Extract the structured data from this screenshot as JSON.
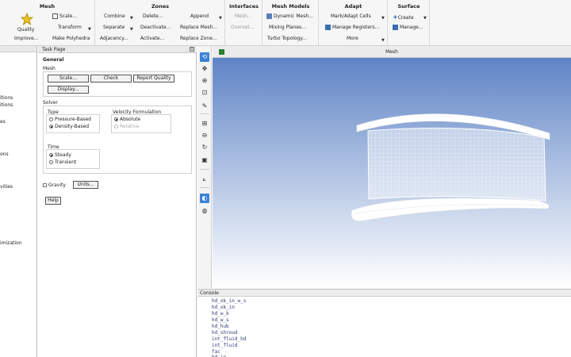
{
  "ribbon": {
    "groups": [
      {
        "title": "Mesh"
      },
      {
        "title": "Zones"
      },
      {
        "title": "Interfaces"
      },
      {
        "title": "Mesh Models"
      },
      {
        "title": "Adapt"
      },
      {
        "title": "Surface"
      }
    ],
    "mesh": {
      "quality": "Quality",
      "improve": "Improve...",
      "scale": "Scale...",
      "transform": "Transform",
      "make_polyhedra": "Make Polyhedra"
    },
    "zones": {
      "combine": "Combine",
      "separate": "Separate",
      "adjacency": "Adjacency...",
      "delete": "Delete...",
      "deactivate": "Deactivate...",
      "activate": "Activate...",
      "append": "Append",
      "replace_mesh": "Replace Mesh...",
      "replace_zone": "Replace Zone..."
    },
    "interfaces": {
      "mesh": "Mesh...",
      "overset": "Overset..."
    },
    "mesh_models": {
      "dynamic_mesh": "Dynamic Mesh...",
      "mixing_planes": "Mixing Planes...",
      "turbo_topology": "Turbo Topology..."
    },
    "adapt": {
      "mark_adapt": "Mark/Adapt Cells",
      "manage_registers": "Manage Registers...",
      "more": "More"
    },
    "surface": {
      "create": "Create",
      "manage": "Manage..."
    }
  },
  "tree": {
    "items": [
      "itions",
      "itions",
      "es",
      "ons",
      "vities",
      "imization"
    ]
  },
  "task_page": {
    "header": "Task Page",
    "title": "General",
    "mesh_label": "Mesh",
    "buttons": {
      "scale": "Scale...",
      "check": "Check",
      "report_quality": "Report Quality",
      "display": "Display..."
    },
    "solver_label": "Solver",
    "type_label": "Type",
    "type_options": [
      "Pressure-Based",
      "Density-Based"
    ],
    "type_selected": "Density-Based",
    "velocity_label": "Velocity Formulation",
    "velocity_options": [
      "Absolute",
      "Relative"
    ],
    "velocity_selected": "Absolute",
    "time_label": "Time",
    "time_options": [
      "Steady",
      "Transient"
    ],
    "time_selected": "Steady",
    "gravity_label": "Gravity",
    "units_button": "Units...",
    "help_button": "Help"
  },
  "graphics": {
    "title": "Mesh"
  },
  "console": {
    "title": "Console",
    "lines": [
      "hd_ok_in_w_s",
      "hd_ok_in",
      "hd_w_k",
      "hd_w_s",
      "hd_hub",
      "hd_shroud",
      "int_fluid_hd",
      "int_fluid",
      "fac",
      "hd_in"
    ]
  },
  "colors": {
    "accent": "#3b83d6",
    "viewport_top": "#5f84c6",
    "viewport_bottom": "#ffffff",
    "console_text": "#2c3a74"
  },
  "icons": {
    "toolbar": [
      "rotate-icon",
      "pan-icon",
      "zoom-in-icon",
      "zoom-box-icon",
      "probe-icon",
      "fit-icon",
      "zoom-out-icon",
      "rotate-3d-icon",
      "view-icon",
      "axes-icon",
      "display-icon",
      "mouse-icon"
    ]
  }
}
